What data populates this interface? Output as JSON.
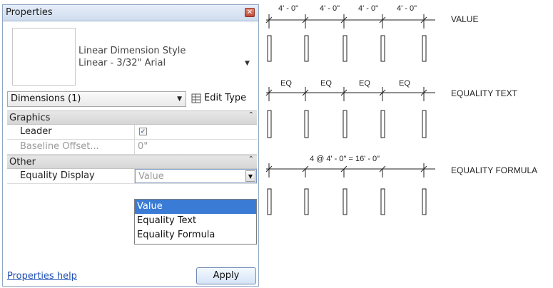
{
  "properties_panel": {
    "title": "Properties",
    "type_selector": {
      "line1": "Linear Dimension Style",
      "line2": "Linear - 3/32\" Arial"
    },
    "filter": {
      "label": "Dimensions (1)"
    },
    "edit_type_label": "Edit Type",
    "groups": [
      {
        "name": "Graphics",
        "rows": [
          {
            "name": "Leader",
            "value_checked": true
          },
          {
            "name": "Baseline Offset...",
            "value": "0\""
          }
        ]
      },
      {
        "name": "Other",
        "rows": [
          {
            "name": "Equality Display",
            "value": "Value"
          }
        ]
      }
    ],
    "equality_options": [
      "Value",
      "Equality Text",
      "Equality Formula"
    ],
    "selected_option": "Value",
    "help_link": "Properties help",
    "apply_label": "Apply"
  },
  "illustration": {
    "value_dims": [
      "4' - 0\"",
      "4' - 0\"",
      "4' - 0\"",
      "4' - 0\""
    ],
    "value_label": "VALUE",
    "eq_dims": [
      "EQ",
      "EQ",
      "EQ",
      "EQ"
    ],
    "eq_label": "EQUALITY TEXT",
    "formula_text": "4 @ 4' - 0\" = 16' - 0\"",
    "formula_label": "EQUALITY FORMULA"
  }
}
